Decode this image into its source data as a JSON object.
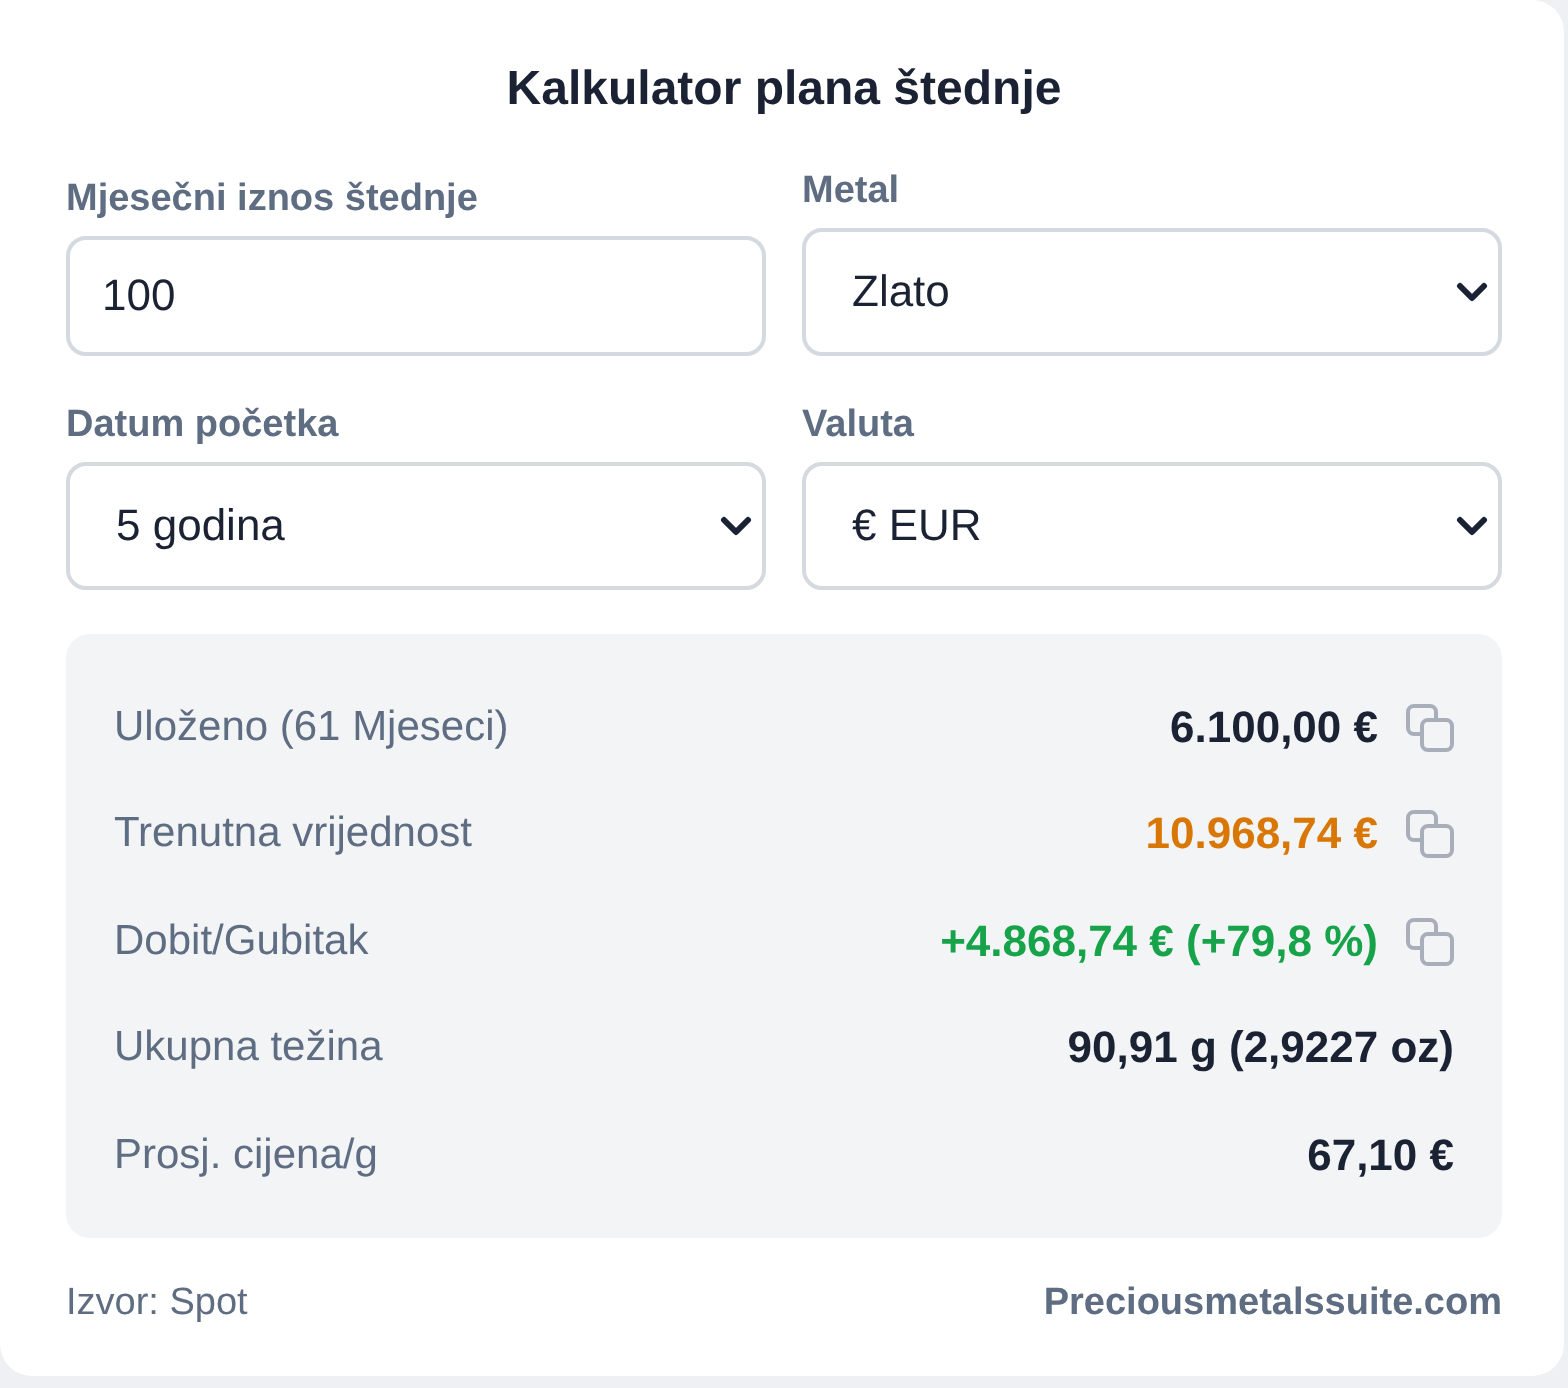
{
  "title": "Kalkulator plana štednje",
  "fields": [
    {
      "kind": "input",
      "label": "Mjesečni iznos štednje",
      "value": "100"
    },
    {
      "kind": "select",
      "label": "Metal",
      "value": "Zlato"
    },
    {
      "kind": "select",
      "label": "Datum početka",
      "value": "5 godina"
    },
    {
      "kind": "select",
      "label": "Valuta",
      "value": "€ EUR"
    }
  ],
  "results": [
    {
      "label": "Uloženo (61 Mjeseci)",
      "value": "6.100,00 €",
      "color": "#1a2233",
      "copyable": true
    },
    {
      "label": "Trenutna vrijednost",
      "value": "10.968,74 €",
      "color": "#d97706",
      "copyable": true
    },
    {
      "label": "Dobit/Gubitak",
      "value": "+4.868,74 € (+79,8 %)",
      "color": "#16a34a",
      "copyable": true
    },
    {
      "label": "Ukupna težina",
      "value": "90,91 g (2,9227 oz)",
      "color": "#1a2233",
      "copyable": false
    },
    {
      "label": "Prosj. cijena/g",
      "value": "67,10 €",
      "color": "#1a2233",
      "copyable": false
    }
  ],
  "footer": {
    "source": "Izvor: Spot",
    "site": "Preciousmetalssuite.com"
  }
}
